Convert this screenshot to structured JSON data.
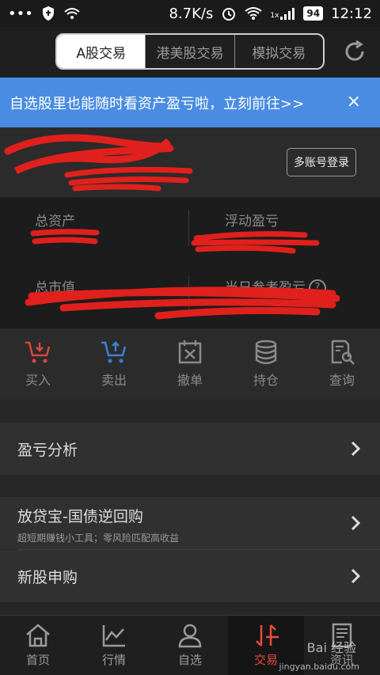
{
  "status_bar": {
    "network_speed": "8.7K/s",
    "battery": "94",
    "time": "12:12",
    "signal_type": "1x"
  },
  "header": {
    "tabs": [
      {
        "label": "A股交易"
      },
      {
        "label": "港美股交易"
      },
      {
        "label": "模拟交易"
      }
    ]
  },
  "banner": {
    "text": "自选股里也能随时看资产盈亏啦，立刻前往>>",
    "close": "×"
  },
  "account": {
    "multi_login_label": "多账号登录"
  },
  "assets": {
    "total_assets_label": "总资产",
    "floating_pl_label": "浮动盈亏",
    "total_market_value_label": "总市值",
    "today_ref_pl_label": "当日参考盈亏"
  },
  "actions": [
    {
      "label": "买入",
      "icon": "cart-down-icon"
    },
    {
      "label": "卖出",
      "icon": "cart-up-icon"
    },
    {
      "label": "撤单",
      "icon": "cancel-order-icon"
    },
    {
      "label": "持仓",
      "icon": "stack-icon"
    },
    {
      "label": "查询",
      "icon": "search-doc-icon"
    }
  ],
  "menu": {
    "pl_analysis": {
      "title": "盈亏分析"
    },
    "reverse_repo": {
      "title": "放贷宝-国债逆回购",
      "subtitle": "超短期赚钱小工具；零风险匹配高收益"
    },
    "ipo": {
      "title": "新股申购"
    }
  },
  "bottom_nav": [
    {
      "label": "首页",
      "icon": "home-icon"
    },
    {
      "label": "行情",
      "icon": "chart-icon"
    },
    {
      "label": "自选",
      "icon": "user-icon"
    },
    {
      "label": "交易",
      "icon": "trade-icon"
    },
    {
      "label": "资讯",
      "icon": "news-icon"
    }
  ],
  "watermark": {
    "text": "Bai 经验",
    "url_text": "jingyan.baidu.com"
  },
  "colors": {
    "accent": "#e84b3c",
    "banner": "#4a8ce1",
    "buy": "#d9453b",
    "sell": "#3d7fd8"
  }
}
